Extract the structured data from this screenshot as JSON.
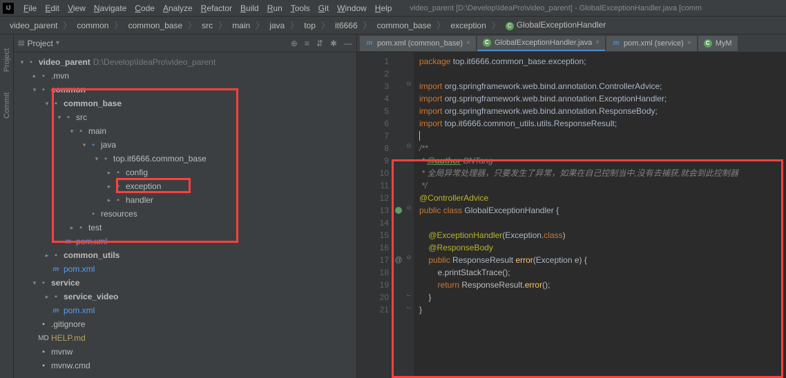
{
  "menubar": {
    "items": [
      "File",
      "Edit",
      "View",
      "Navigate",
      "Code",
      "Analyze",
      "Refactor",
      "Build",
      "Run",
      "Tools",
      "Git",
      "Window",
      "Help"
    ],
    "title": "video_parent [D:\\Develop\\IdeaPro\\video_parent] - GlobalExceptionHandler.java [comm"
  },
  "breadcrumb": [
    "video_parent",
    "common",
    "common_base",
    "src",
    "main",
    "java",
    "top",
    "it6666",
    "common_base",
    "exception",
    "GlobalExceptionHandler"
  ],
  "project": {
    "title": "Project",
    "root": {
      "label": "video_parent",
      "path": "D:\\Develop\\IdeaPro\\video_parent"
    },
    "tree": [
      {
        "depth": 1,
        "arrow": "right",
        "icon": "folder",
        "label": ".mvn"
      },
      {
        "depth": 1,
        "arrow": "down",
        "icon": "folder-bold",
        "label": "common",
        "bold": true
      },
      {
        "depth": 2,
        "arrow": "down",
        "icon": "folder-bold",
        "label": "common_base",
        "bold": true
      },
      {
        "depth": 3,
        "arrow": "down",
        "icon": "folder",
        "label": "src"
      },
      {
        "depth": 4,
        "arrow": "down",
        "icon": "folder",
        "label": "main"
      },
      {
        "depth": 5,
        "arrow": "down",
        "icon": "folder-blue",
        "label": "java"
      },
      {
        "depth": 6,
        "arrow": "down",
        "icon": "folder",
        "label": "top.it6666.common_base"
      },
      {
        "depth": 7,
        "arrow": "right",
        "icon": "folder",
        "label": "config"
      },
      {
        "depth": 7,
        "arrow": "right",
        "icon": "folder",
        "label": "exception"
      },
      {
        "depth": 7,
        "arrow": "right",
        "icon": "folder",
        "label": "handler"
      },
      {
        "depth": 5,
        "arrow": "none",
        "icon": "folder",
        "label": "resources"
      },
      {
        "depth": 4,
        "arrow": "right",
        "icon": "folder",
        "label": "test"
      },
      {
        "depth": 3,
        "arrow": "none",
        "icon": "pom",
        "label": "pom.xml",
        "blue": true
      },
      {
        "depth": 2,
        "arrow": "right",
        "icon": "folder-bold",
        "label": "common_utils",
        "bold": true
      },
      {
        "depth": 2,
        "arrow": "none",
        "icon": "pom",
        "label": "pom.xml",
        "blue": true
      },
      {
        "depth": 1,
        "arrow": "down",
        "icon": "folder-bold",
        "label": "service",
        "bold": true
      },
      {
        "depth": 2,
        "arrow": "right",
        "icon": "folder-bold",
        "label": "service_video",
        "bold": true
      },
      {
        "depth": 2,
        "arrow": "none",
        "icon": "pom",
        "label": "pom.xml",
        "blue": true
      },
      {
        "depth": 1,
        "arrow": "none",
        "icon": "file",
        "label": ".gitignore"
      },
      {
        "depth": 1,
        "arrow": "none",
        "icon": "md",
        "label": "HELP.md",
        "yellow": true
      },
      {
        "depth": 1,
        "arrow": "none",
        "icon": "file",
        "label": "mvnw"
      },
      {
        "depth": 1,
        "arrow": "none",
        "icon": "file",
        "label": "mvnw.cmd"
      }
    ]
  },
  "tabs": [
    {
      "icon": "m",
      "label": "pom.xml (common_base)",
      "active": false
    },
    {
      "icon": "c",
      "label": "GlobalExceptionHandler.java",
      "active": true
    },
    {
      "icon": "m",
      "label": "pom.xml (service)",
      "active": false
    },
    {
      "icon": "c",
      "label": "MyM",
      "active": false,
      "partial": true
    }
  ],
  "code": {
    "lines": [
      {
        "n": 1,
        "html": "<span class='kw'>package</span> <span class='id'>top.it6666.common_base.exception;</span>"
      },
      {
        "n": 2,
        "html": ""
      },
      {
        "n": 3,
        "html": "<span class='kw'>import</span> <span class='id'>org.springframework.web.bind.annotation.ControllerAdvice;</span>"
      },
      {
        "n": 4,
        "html": "<span class='kw'>import</span> <span class='id'>org.springframework.web.bind.annotation.ExceptionHandler;</span>"
      },
      {
        "n": 5,
        "html": "<span class='kw'>import</span> <span class='id'>org.springframework.web.bind.annotation.ResponseBody;</span>"
      },
      {
        "n": 6,
        "html": "<span class='kw'>import</span> <span class='id'>top.it6666.common_utils.utils.ResponseResult;</span>"
      },
      {
        "n": 7,
        "html": "<span class='caret'></span>"
      },
      {
        "n": 8,
        "html": "<span class='cmt'>/**</span>"
      },
      {
        "n": 9,
        "html": "<span class='cmt'> * </span><span class='cmt-tag'>@author</span><span class='cmt-auth'> BNTang</span>"
      },
      {
        "n": 10,
        "html": "<span class='cmt'> * 全局异常处理器，只要发生了异常，如果在自己控制当中,没有去捕获,就会到此控制器</span>"
      },
      {
        "n": 11,
        "html": "<span class='cmt'> */</span>"
      },
      {
        "n": 12,
        "html": "<span class='ann'>@ControllerAdvice</span>"
      },
      {
        "n": 13,
        "html": "<span class='kw'>public</span> <span class='kw'>class</span> <span class='type'>GlobalExceptionHandler</span> {"
      },
      {
        "n": 14,
        "html": ""
      },
      {
        "n": 15,
        "html": "    <span class='ann'>@ExceptionHandler</span>(<span class='type'>Exception</span>.<span class='kw'>class</span>)"
      },
      {
        "n": 16,
        "html": "    <span class='ann'>@ResponseBody</span>"
      },
      {
        "n": 17,
        "html": "    <span class='kw'>public</span> <span class='type'>ResponseResult</span> <span class='fn'>error</span>(<span class='type'>Exception</span> e) {"
      },
      {
        "n": 18,
        "html": "        e.printStackTrace();"
      },
      {
        "n": 19,
        "html": "        <span class='kw'>return</span> ResponseResult.<span class='fn'>error</span>();"
      },
      {
        "n": 20,
        "html": "    }"
      },
      {
        "n": 21,
        "html": "}"
      }
    ],
    "folds": {
      "3": "⊖",
      "8": "⊖",
      "13": "⊖",
      "17": "⊖",
      "20": "⌙",
      "21": "⌙"
    },
    "gutter_icons": {
      "13": "bean",
      "17": "at"
    }
  },
  "side_tabs": [
    "Project",
    "Commit"
  ]
}
